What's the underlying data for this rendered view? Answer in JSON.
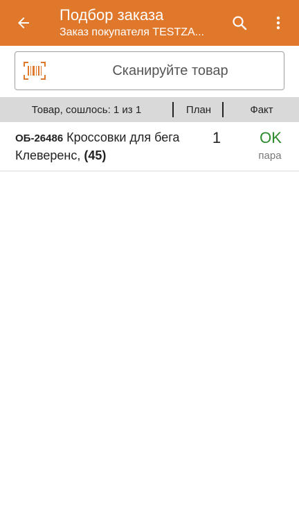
{
  "appbar": {
    "title": "Подбор заказа",
    "subtitle": "Заказ покупателя TESTZA...",
    "back_icon": "arrow-back-icon",
    "search_icon": "search-icon",
    "menu_icon": "more-vert-icon",
    "background_color": "#e0782c"
  },
  "scan": {
    "label": "Сканируйте товар",
    "icon": "barcode-icon",
    "icon_color": "#e0782c"
  },
  "table": {
    "headers": {
      "name": "Товар, сошлось: 1 из 1",
      "plan": "План",
      "fact": "Факт"
    },
    "rows": [
      {
        "code": "ОБ-26486",
        "name": "Кроссовки для бега Клеверенс,",
        "qty_label": "(45)",
        "plan": "1",
        "status": "OK",
        "unit": "пара"
      }
    ]
  },
  "colors": {
    "accent": "#e0782c",
    "ok": "#2b8a2b",
    "header_bg": "#d9d9d9"
  }
}
